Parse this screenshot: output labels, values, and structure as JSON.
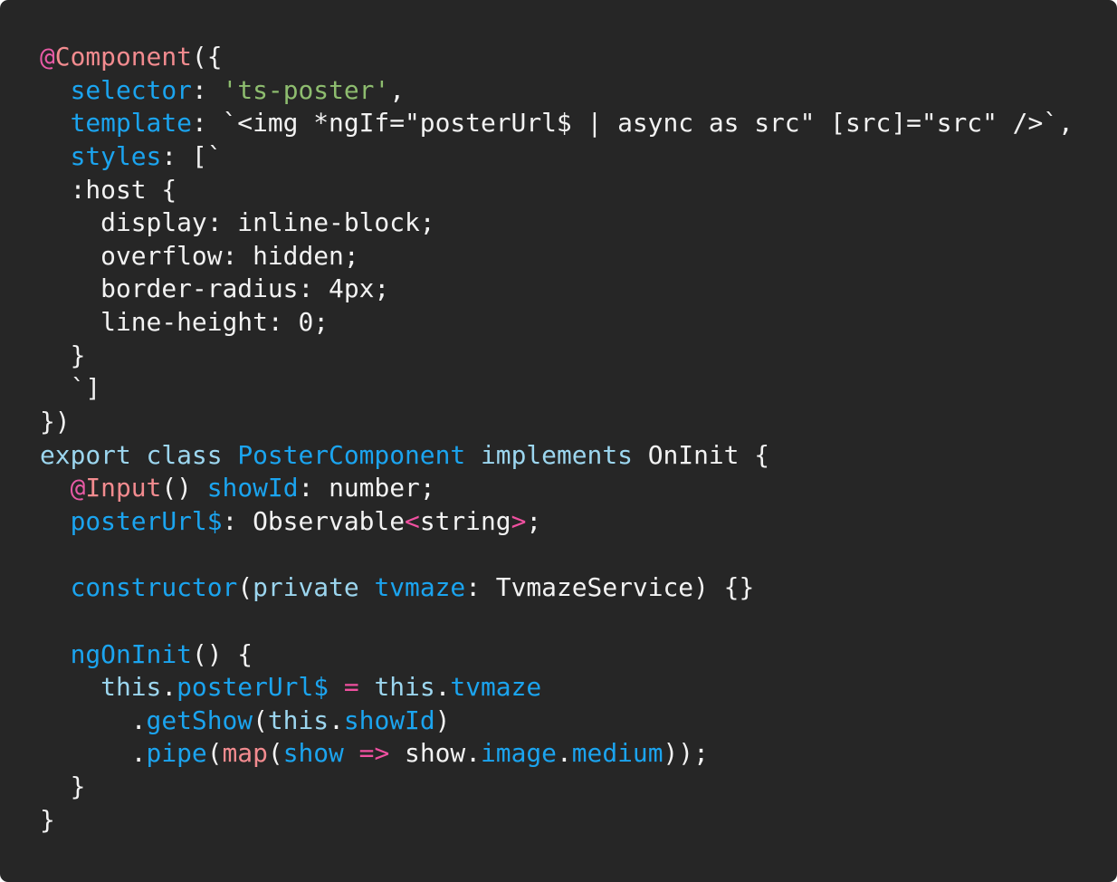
{
  "code": {
    "language": "typescript",
    "lines": [
      [
        [
          "at",
          "@"
        ],
        [
          "dec",
          "Component"
        ],
        [
          "plain",
          "({"
        ]
      ],
      [
        [
          "plain",
          "  "
        ],
        [
          "prop",
          "selector"
        ],
        [
          "plain",
          ": "
        ],
        [
          "str",
          "'ts-poster'"
        ],
        [
          "plain",
          ","
        ]
      ],
      [
        [
          "plain",
          "  "
        ],
        [
          "prop",
          "template"
        ],
        [
          "plain",
          ": `<img *ngIf=\"posterUrl$ | async as src\" [src]=\"src\" />`,"
        ]
      ],
      [
        [
          "plain",
          "  "
        ],
        [
          "prop",
          "styles"
        ],
        [
          "plain",
          ": [`"
        ]
      ],
      [
        [
          "plain",
          "  :host {"
        ]
      ],
      [
        [
          "plain",
          "    display: inline-block;"
        ]
      ],
      [
        [
          "plain",
          "    overflow: hidden;"
        ]
      ],
      [
        [
          "plain",
          "    border-radius: 4px;"
        ]
      ],
      [
        [
          "plain",
          "    line-height: 0;"
        ]
      ],
      [
        [
          "plain",
          "  }"
        ]
      ],
      [
        [
          "plain",
          "  `]"
        ]
      ],
      [
        [
          "plain",
          "})"
        ]
      ],
      [
        [
          "kw",
          "export"
        ],
        [
          "plain",
          " "
        ],
        [
          "kw",
          "class"
        ],
        [
          "plain",
          " "
        ],
        [
          "prop",
          "PosterComponent"
        ],
        [
          "plain",
          " "
        ],
        [
          "kw",
          "implements"
        ],
        [
          "plain",
          " OnInit {"
        ]
      ],
      [
        [
          "plain",
          "  "
        ],
        [
          "at",
          "@"
        ],
        [
          "dec",
          "Input"
        ],
        [
          "plain",
          "() "
        ],
        [
          "prop",
          "showId"
        ],
        [
          "plain",
          ": number;"
        ]
      ],
      [
        [
          "plain",
          "  "
        ],
        [
          "prop",
          "posterUrl$"
        ],
        [
          "plain",
          ": Observable"
        ],
        [
          "op",
          "<"
        ],
        [
          "plain",
          "string"
        ],
        [
          "op",
          ">"
        ],
        [
          "plain",
          ";"
        ]
      ],
      [
        [
          "plain",
          ""
        ]
      ],
      [
        [
          "plain",
          "  "
        ],
        [
          "prop",
          "constructor"
        ],
        [
          "plain",
          "("
        ],
        [
          "kw",
          "private"
        ],
        [
          "plain",
          " "
        ],
        [
          "prop",
          "tvmaze"
        ],
        [
          "plain",
          ": TvmazeService) {}"
        ]
      ],
      [
        [
          "plain",
          ""
        ]
      ],
      [
        [
          "plain",
          "  "
        ],
        [
          "prop",
          "ngOnInit"
        ],
        [
          "plain",
          "() {"
        ]
      ],
      [
        [
          "plain",
          "    "
        ],
        [
          "kw",
          "this"
        ],
        [
          "plain",
          "."
        ],
        [
          "prop",
          "posterUrl$"
        ],
        [
          "plain",
          " "
        ],
        [
          "op",
          "="
        ],
        [
          "plain",
          " "
        ],
        [
          "kw",
          "this"
        ],
        [
          "plain",
          "."
        ],
        [
          "prop",
          "tvmaze"
        ]
      ],
      [
        [
          "plain",
          "      ."
        ],
        [
          "prop",
          "getShow"
        ],
        [
          "plain",
          "("
        ],
        [
          "kw",
          "this"
        ],
        [
          "plain",
          "."
        ],
        [
          "prop",
          "showId"
        ],
        [
          "plain",
          ")"
        ]
      ],
      [
        [
          "plain",
          "      ."
        ],
        [
          "prop",
          "pipe"
        ],
        [
          "plain",
          "("
        ],
        [
          "fn",
          "map"
        ],
        [
          "plain",
          "("
        ],
        [
          "prop",
          "show"
        ],
        [
          "plain",
          " "
        ],
        [
          "op",
          "=>"
        ],
        [
          "plain",
          " show."
        ],
        [
          "prop",
          "image"
        ],
        [
          "plain",
          "."
        ],
        [
          "prop",
          "medium"
        ],
        [
          "plain",
          "));"
        ]
      ],
      [
        [
          "plain",
          "  }"
        ]
      ],
      [
        [
          "plain",
          "}"
        ]
      ]
    ]
  },
  "colors": {
    "background": "#262626",
    "text": "#f2f2f2",
    "property": "#1ba4ef",
    "keyword": "#9cd6ef",
    "decorator_at": "#e85aa5",
    "decorator_name": "#f28b8f",
    "string": "#8ebd6f",
    "operator": "#f050a0"
  }
}
